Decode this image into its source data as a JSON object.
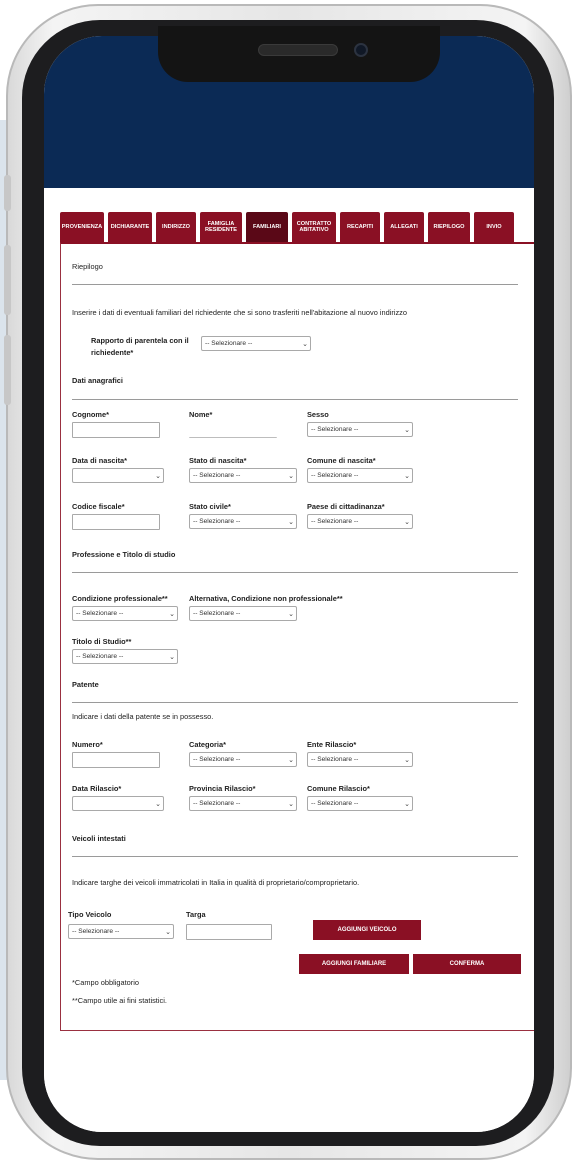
{
  "tabs": [
    {
      "label": "PROVENIENZA"
    },
    {
      "label": "DICHIARANTE"
    },
    {
      "label": "INDIRIZZO"
    },
    {
      "label": "FAMIGLIA RESIDENTE"
    },
    {
      "label": "FAMILIARI"
    },
    {
      "label": "CONTRATTO ABITATIVO"
    },
    {
      "label": "RECAPITI"
    },
    {
      "label": "ALLEGATI"
    },
    {
      "label": "RIEPILOGO"
    },
    {
      "label": "INVIO"
    }
  ],
  "active_tab": "FAMILIARI",
  "form": {
    "riepilogo_title": "Riepilogo",
    "intro": "Inserire i dati di eventuali familiari del richiedente che si sono trasferiti nell'abitazione al nuovo indirizzo",
    "rapporto_label_1": "Rapporto di parentela con il",
    "rapporto_label_2": "richiedente*",
    "select_placeholder": "-- Selezionare --",
    "dati_anagrafici": "Dati anagrafici",
    "cognome": "Cognome*",
    "nome": "Nome*",
    "sesso": "Sesso",
    "data_nascita": "Data di nascita*",
    "stato_nascita": "Stato di nascita*",
    "comune_nascita": "Comune di nascita*",
    "codice_fiscale": "Codice fiscale*",
    "stato_civile": "Stato civile*",
    "paese_cittadinanza": "Paese di cittadinanza*",
    "professione_titolo": "Professione e Titolo di studio",
    "condizione_prof": "Condizione professionale**",
    "condizione_non_prof": "Alternativa, Condizione non professionale**",
    "titolo_studio": "Titolo di Studio**",
    "patente": "Patente",
    "patente_intro": "Indicare i dati della patente se in possesso.",
    "numero": "Numero*",
    "categoria": "Categoria*",
    "ente_rilascio": "Ente Rilascio*",
    "data_rilascio": "Data Rilascio*",
    "provincia_rilascio": "Provincia Rilascio*",
    "comune_rilascio": "Comune Rilascio*",
    "veicoli_intestati": "Veicoli intestati",
    "veicoli_intro": "Indicare targhe dei veicoli immatricolati in Italia in qualità di proprietario/comproprietario.",
    "tipo_veicolo": "Tipo Veicolo",
    "targa": "Targa",
    "aggiungi_veicolo": "AGGIUNGI VEICOLO",
    "aggiungi_familiare": "AGGIUNGI FAMILIARE",
    "conferma": "CONFERMA",
    "note_obbligatorio": "*Campo obbligatorio",
    "note_statistici": "**Campo utile ai fini statistici."
  },
  "colors": {
    "header_navy": "#0b2a55",
    "tab_maroon": "#8a1024",
    "tab_active": "#5a0817"
  },
  "icons": {
    "select_arrow": "chevron-down-icon"
  }
}
